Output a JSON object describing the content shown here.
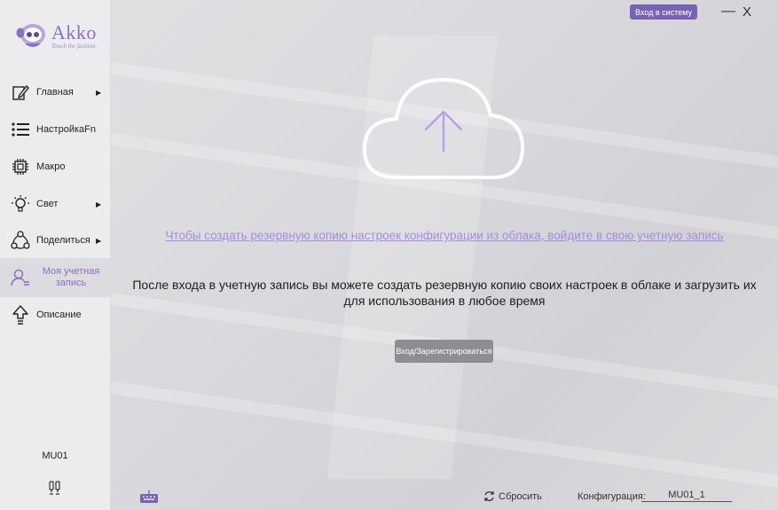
{
  "brand": {
    "name": "Akko",
    "tagline": "Touch the fashion."
  },
  "sidebar": {
    "items": [
      {
        "label": "Главная",
        "icon": "edit-icon",
        "arrow": "▶"
      },
      {
        "label": "НастройкаFn",
        "icon": "list-icon",
        "arrow": ""
      },
      {
        "label": "Макро",
        "icon": "chip-icon",
        "arrow": ""
      },
      {
        "label": "Свет",
        "icon": "bulb-icon",
        "arrow": "▶"
      },
      {
        "label": "Поделиться",
        "icon": "share-icon",
        "arrow": "▶"
      },
      {
        "label": "Моя учетная запись",
        "icon": "user-icon",
        "arrow": ""
      },
      {
        "label": "Описание",
        "icon": "upload-icon",
        "arrow": ""
      }
    ],
    "device": "MU01"
  },
  "header": {
    "login_label": "Вход в систему",
    "minimize": "—",
    "close": "X"
  },
  "main": {
    "link_text": "Чтобы создать резервную копию настроек конфигурации из облака, войдите в свою учетную запись",
    "description_line1": "После входа в учетную запись вы можете создать резервную копию своих настроек в облаке и загрузить их",
    "description_line2": "для использования в любое время",
    "register_label": "Вход/Зарегистрироваться"
  },
  "footer": {
    "reset_label": "Сбросить",
    "config_label": "Конфигурация:",
    "config_value": "MU01_1"
  },
  "colors": {
    "accent": "#8a6fc4",
    "link": "#a68be0",
    "button_grey": "#8e8e92"
  }
}
